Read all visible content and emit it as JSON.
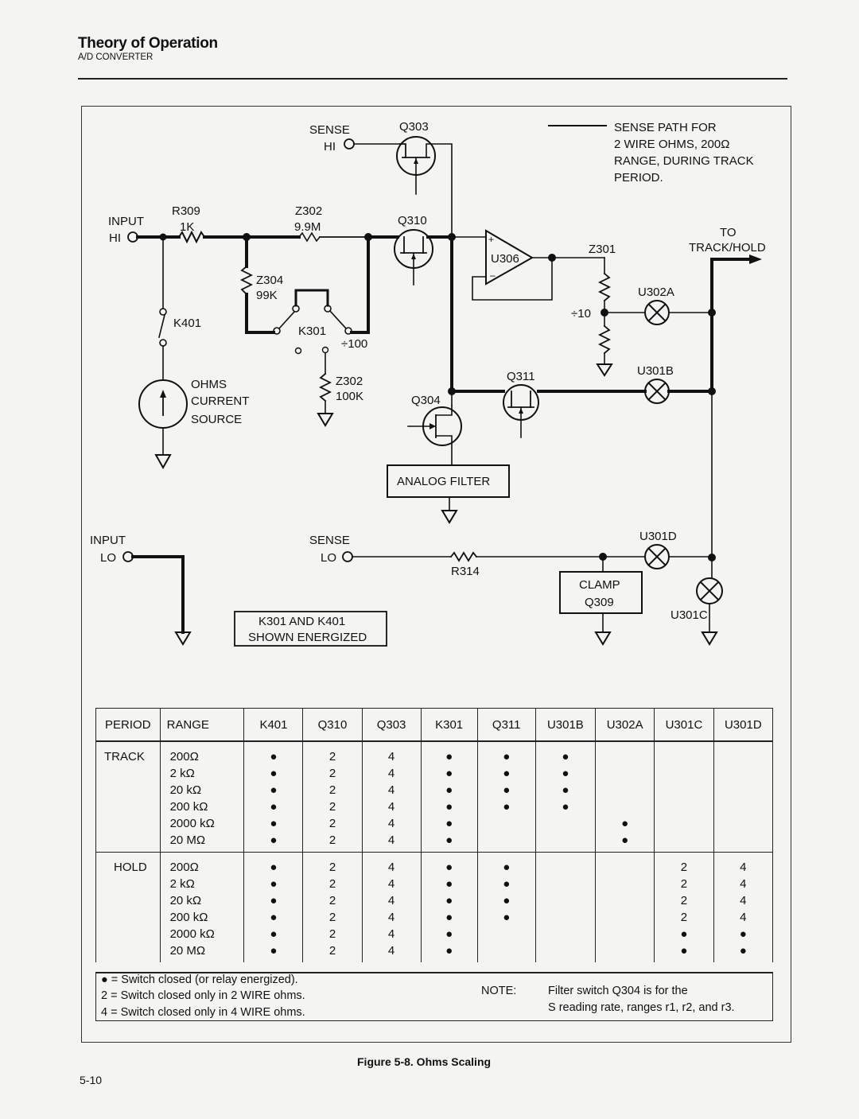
{
  "header": {
    "title": "Theory of Operation",
    "subtitle": "A/D CONVERTER"
  },
  "schematic": {
    "legend_text": [
      "SENSE PATH FOR",
      "2 WIRE OHMS, 200Ω",
      "RANGE, DURING TRACK",
      "PERIOD."
    ],
    "input_hi": [
      "INPUT",
      "HI"
    ],
    "input_lo": [
      "INPUT",
      "LO"
    ],
    "sense_hi": [
      "SENSE",
      "HI"
    ],
    "sense_lo": [
      "SENSE",
      "LO"
    ],
    "r309": [
      "R309",
      "1K"
    ],
    "z302_top": [
      "Z302",
      "9.9M"
    ],
    "z304": [
      "Z304",
      "99K"
    ],
    "z302_bot": [
      "Z302",
      "100K"
    ],
    "k401": "K401",
    "k301": "K301",
    "div100": "÷100",
    "div10": "÷10",
    "ohms_source": [
      "OHMS",
      "CURRENT",
      "SOURCE"
    ],
    "q303": "Q303",
    "q310": "Q310",
    "q311": "Q311",
    "q304": "Q304",
    "u306": "U306",
    "z301": "Z301",
    "to_track_hold": [
      "TO",
      "TRACK/HOLD"
    ],
    "u302a": "U302A",
    "u301b": "U301B",
    "u301c": "U301C",
    "u301d": "U301D",
    "analog_filter": "ANALOG FILTER",
    "r314": "R314",
    "clamp": [
      "CLAMP",
      "Q309"
    ],
    "energized_note": [
      "K301 AND K401",
      "SHOWN ENERGIZED"
    ]
  },
  "table": {
    "headers": [
      "PERIOD",
      "RANGE",
      "K401",
      "Q310",
      "Q303",
      "K301",
      "Q311",
      "U301B",
      "U302A",
      "U301C",
      "U301D"
    ],
    "groups": [
      {
        "period": "TRACK",
        "ranges": [
          "200Ω",
          "2 kΩ",
          "20 kΩ",
          "200 kΩ",
          "2000 kΩ",
          "20 MΩ"
        ],
        "columns": {
          "K401": [
            "●",
            "●",
            "●",
            "●",
            "●",
            "●"
          ],
          "Q310": [
            "2",
            "2",
            "2",
            "2",
            "2",
            "2"
          ],
          "Q303": [
            "4",
            "4",
            "4",
            "4",
            "4",
            "4"
          ],
          "K301": [
            "●",
            "●",
            "●",
            "●",
            "●",
            "●"
          ],
          "Q311": [
            "●",
            "●",
            "●",
            "●",
            "",
            ""
          ],
          "U301B": [
            "●",
            "●",
            "●",
            "●",
            "",
            ""
          ],
          "U302A": [
            "",
            "",
            "",
            "",
            "●",
            "●"
          ],
          "U301C": [
            "",
            "",
            "",
            "",
            "",
            ""
          ],
          "U301D": [
            "",
            "",
            "",
            "",
            "",
            ""
          ]
        }
      },
      {
        "period": "HOLD",
        "ranges": [
          "200Ω",
          "2 kΩ",
          "20 kΩ",
          "200 kΩ",
          "2000 kΩ",
          "20 MΩ"
        ],
        "columns": {
          "K401": [
            "●",
            "●",
            "●",
            "●",
            "●",
            "●"
          ],
          "Q310": [
            "2",
            "2",
            "2",
            "2",
            "2",
            "2"
          ],
          "Q303": [
            "4",
            "4",
            "4",
            "4",
            "4",
            "4"
          ],
          "K301": [
            "●",
            "●",
            "●",
            "●",
            "●",
            "●"
          ],
          "Q311": [
            "●",
            "●",
            "●",
            "●",
            "",
            ""
          ],
          "U301B": [
            "",
            "",
            "",
            "",
            "",
            ""
          ],
          "U302A": [
            "",
            "",
            "",
            "",
            "",
            ""
          ],
          "U301C": [
            "2",
            "2",
            "2",
            "2",
            "●",
            "●"
          ],
          "U301D": [
            "4",
            "4",
            "4",
            "4",
            "●",
            "●"
          ]
        }
      }
    ]
  },
  "legend": {
    "dot": "● = Switch closed (or relay energized).",
    "two": "2 = Switch closed only in 2 WIRE ohms.",
    "four": "4 = Switch closed only in 4 WIRE ohms.",
    "note_label": "NOTE:",
    "note_line1": "Filter switch Q304 is for the",
    "note_line2": "S reading rate, ranges r1, r2, and r3."
  },
  "caption": "Figure 5-8. Ohms Scaling",
  "page_number": "5-10"
}
